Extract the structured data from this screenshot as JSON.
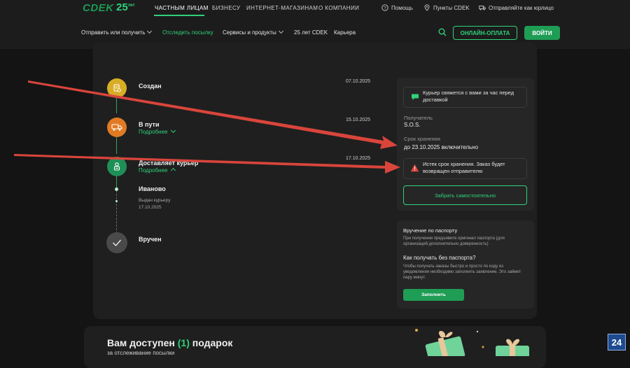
{
  "top": {
    "logo": "CDEK",
    "logo_25": "25",
    "logo_25_sup": "лет",
    "links": [
      "ЧАСТНЫМ ЛИЦАМ",
      "БИЗНЕСУ",
      "ИНТЕРНЕТ-МАГАЗИНАМ",
      "О КОМПАНИИ"
    ],
    "help": "Помощь",
    "points": "Пункты CDEK",
    "send_legal": "Отправляйте как юрлицо"
  },
  "nav": {
    "send": "Отправить или получить",
    "track": "Отследить посылку",
    "services": "Сервисы и продукты",
    "anniv": "25 лет CDEK",
    "career": "Карьера",
    "online_pay": "ОНЛАЙН-ОПЛАТА",
    "login": "ВОЙТИ"
  },
  "timeline": {
    "created": {
      "title": "Создан",
      "date": "07.10.2025"
    },
    "transit": {
      "title": "В пути",
      "more": "Подробнее",
      "date": "15.10.2025"
    },
    "courier": {
      "title": "Доставляет курьер",
      "more": "Подробнее",
      "date": "17.10.2025"
    },
    "sub": {
      "city": "Иваново",
      "status": "Выдан курьеру",
      "date": "17.10.2025"
    },
    "received": {
      "title": "Вручен"
    }
  },
  "info": {
    "courier_msg": "Курьер свяжется с вами за час перед доставкой",
    "recipient_label": "Получатель",
    "recipient": "S.O.S.",
    "storage_label": "Срок хранения",
    "storage": "до 23.10.2025 включительно",
    "expired_msg": "Истек срок хранения. Заказ будет возвращен отправителю",
    "pickup": "Забрать самостоятельно"
  },
  "passport": {
    "title": "Вручение по паспорту",
    "text": "При получении предъявите оригинал паспорта (для организаций дополнительно доверенность)",
    "q": "Как получать без паспорта?",
    "q_text": "Чтобы получать заказы быстро и просто по коду из уведомления необходимо заполнить заявление. Это займет пару минут.",
    "fill": "Заполнить"
  },
  "gift": {
    "title_a": "Вам доступен ",
    "count": "(1)",
    "title_b": " подарок",
    "sub": "за отслеживание посылки"
  },
  "badge": "24",
  "colors": {
    "accent": "#2fd27a",
    "warn": "#e0463e",
    "arrow": "#d9453b"
  }
}
